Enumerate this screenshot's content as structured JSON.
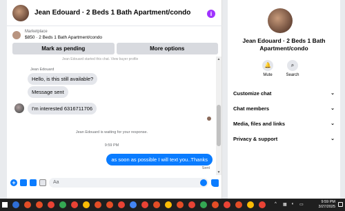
{
  "chat": {
    "title": "Jean Edouard · 2 Beds 1 Bath Apartment/condo",
    "marketplace": {
      "label": "Marketplace",
      "listing": "$850 · 2 Beds 1 Bath Apartment/condo",
      "buttons": [
        "Mark as pending",
        "More options"
      ]
    },
    "messages": {
      "truncated_note": "Jean Edouard started this chat. View buyer profile",
      "sender_name": "Jean Edouard",
      "incoming": [
        "Hello, is this still available?",
        "Message sent",
        "I'm interested 6316711706"
      ],
      "waiting_note": "Jean Edouard is waiting for your response.",
      "timestamp": "9:59 PM",
      "outgoing": "as soon as possible I will text you..Thanks",
      "status": "Sent"
    },
    "composer": {
      "placeholder": "Aa"
    }
  },
  "info": {
    "name": "Jean Edouard · 2 Beds 1 Bath Apartment/condo",
    "actions": [
      "Mute",
      "Search"
    ],
    "sections": [
      "Customize chat",
      "Chat members",
      "Media, files and links",
      "Privacy & support"
    ]
  },
  "taskbar": {
    "time": "9:59 PM",
    "date": "3/27/2025",
    "colors": [
      "#2f6fd6",
      "#e44d26",
      "#e44d26",
      "#ea4335",
      "#34a853",
      "#ea4335",
      "#fbbc05",
      "#e44d26",
      "#e44d26",
      "#ea4335",
      "#4285f4",
      "#ea4335",
      "#e44d26",
      "#fbbc05",
      "#e44d26",
      "#ea4335",
      "#34a853",
      "#e44d26",
      "#ea4335",
      "#e44d26",
      "#fbbc05",
      "#ea4335"
    ]
  },
  "colors": {
    "accent": "#0a7cff",
    "info_icon": "#a033ff"
  }
}
